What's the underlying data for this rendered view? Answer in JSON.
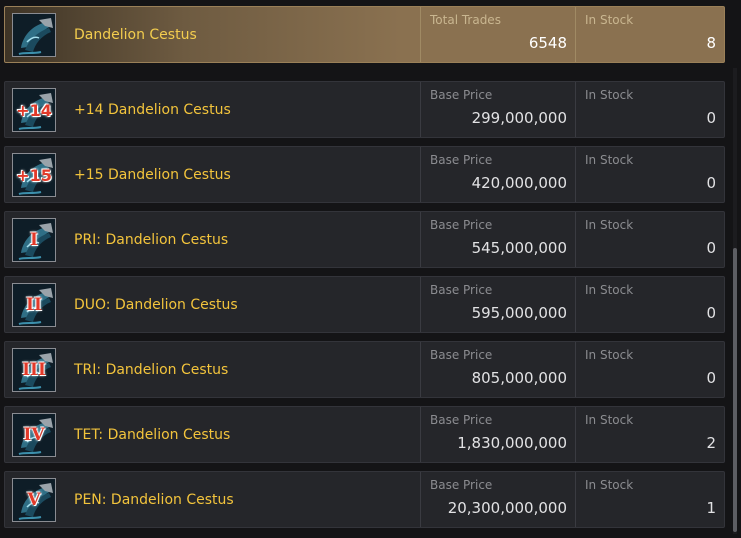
{
  "header": {
    "name": "Dandelion Cestus",
    "stat_label": "Total Trades",
    "stat_value": "6548",
    "stock_label": "In Stock",
    "stock_value": "8"
  },
  "rows": [
    {
      "badge": "+14",
      "name": "+14 Dandelion Cestus",
      "price_label": "Base Price",
      "price": "299,000,000",
      "stock_label": "In Stock",
      "stock": "0"
    },
    {
      "badge": "+15",
      "name": "+15 Dandelion Cestus",
      "price_label": "Base Price",
      "price": "420,000,000",
      "stock_label": "In Stock",
      "stock": "0"
    },
    {
      "badge": "I",
      "name": "PRI: Dandelion Cestus",
      "price_label": "Base Price",
      "price": "545,000,000",
      "stock_label": "In Stock",
      "stock": "0"
    },
    {
      "badge": "II",
      "name": "DUO: Dandelion Cestus",
      "price_label": "Base Price",
      "price": "595,000,000",
      "stock_label": "In Stock",
      "stock": "0"
    },
    {
      "badge": "III",
      "name": "TRI: Dandelion Cestus",
      "price_label": "Base Price",
      "price": "805,000,000",
      "stock_label": "In Stock",
      "stock": "0"
    },
    {
      "badge": "IV",
      "name": "TET: Dandelion Cestus",
      "price_label": "Base Price",
      "price": "1,830,000,000",
      "stock_label": "In Stock",
      "stock": "2"
    },
    {
      "badge": "V",
      "name": "PEN: Dandelion Cestus",
      "price_label": "Base Price",
      "price": "20,300,000,000",
      "stock_label": "In Stock",
      "stock": "1"
    }
  ],
  "icons": {
    "item": "cestus-icon"
  },
  "colors": {
    "item_name": "#f3c43c",
    "badge": "#e23a2a",
    "header_bg": "#8a7150",
    "row_bg": "#25262a"
  }
}
